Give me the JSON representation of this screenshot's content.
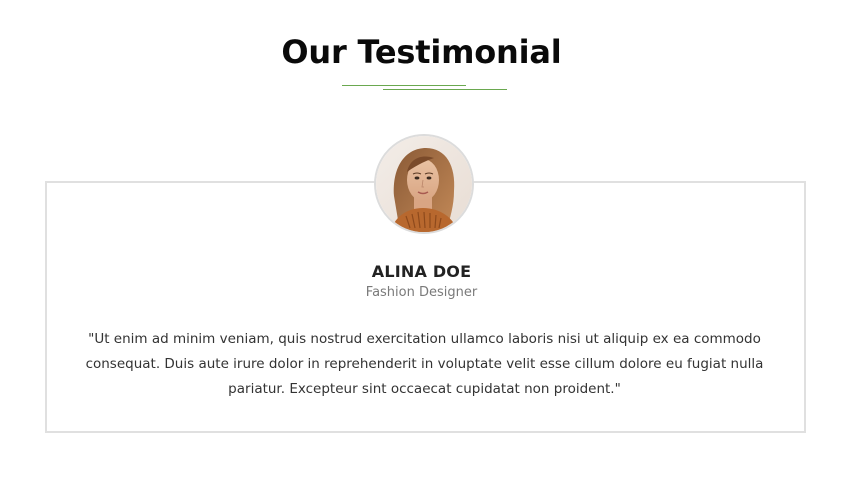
{
  "section": {
    "title": "Our Testimonial"
  },
  "testimonial": {
    "name": "ALINA DOE",
    "role": "Fashion Designer",
    "quote": "\"Ut enim ad minim veniam, quis nostrud exercitation ullamco laboris nisi ut aliquip ex ea commodo consequat. Duis aute irure dolor in reprehenderit in voluptate velit esse cillum dolore eu fugiat nulla pariatur. Excepteur sint occaecat cupidatat non proident.\""
  },
  "colors": {
    "accent": "#6aa84f",
    "card_border": "#e0e0e0",
    "title": "#0a0a0a",
    "text": "#333333",
    "muted": "#7a7a7a"
  }
}
